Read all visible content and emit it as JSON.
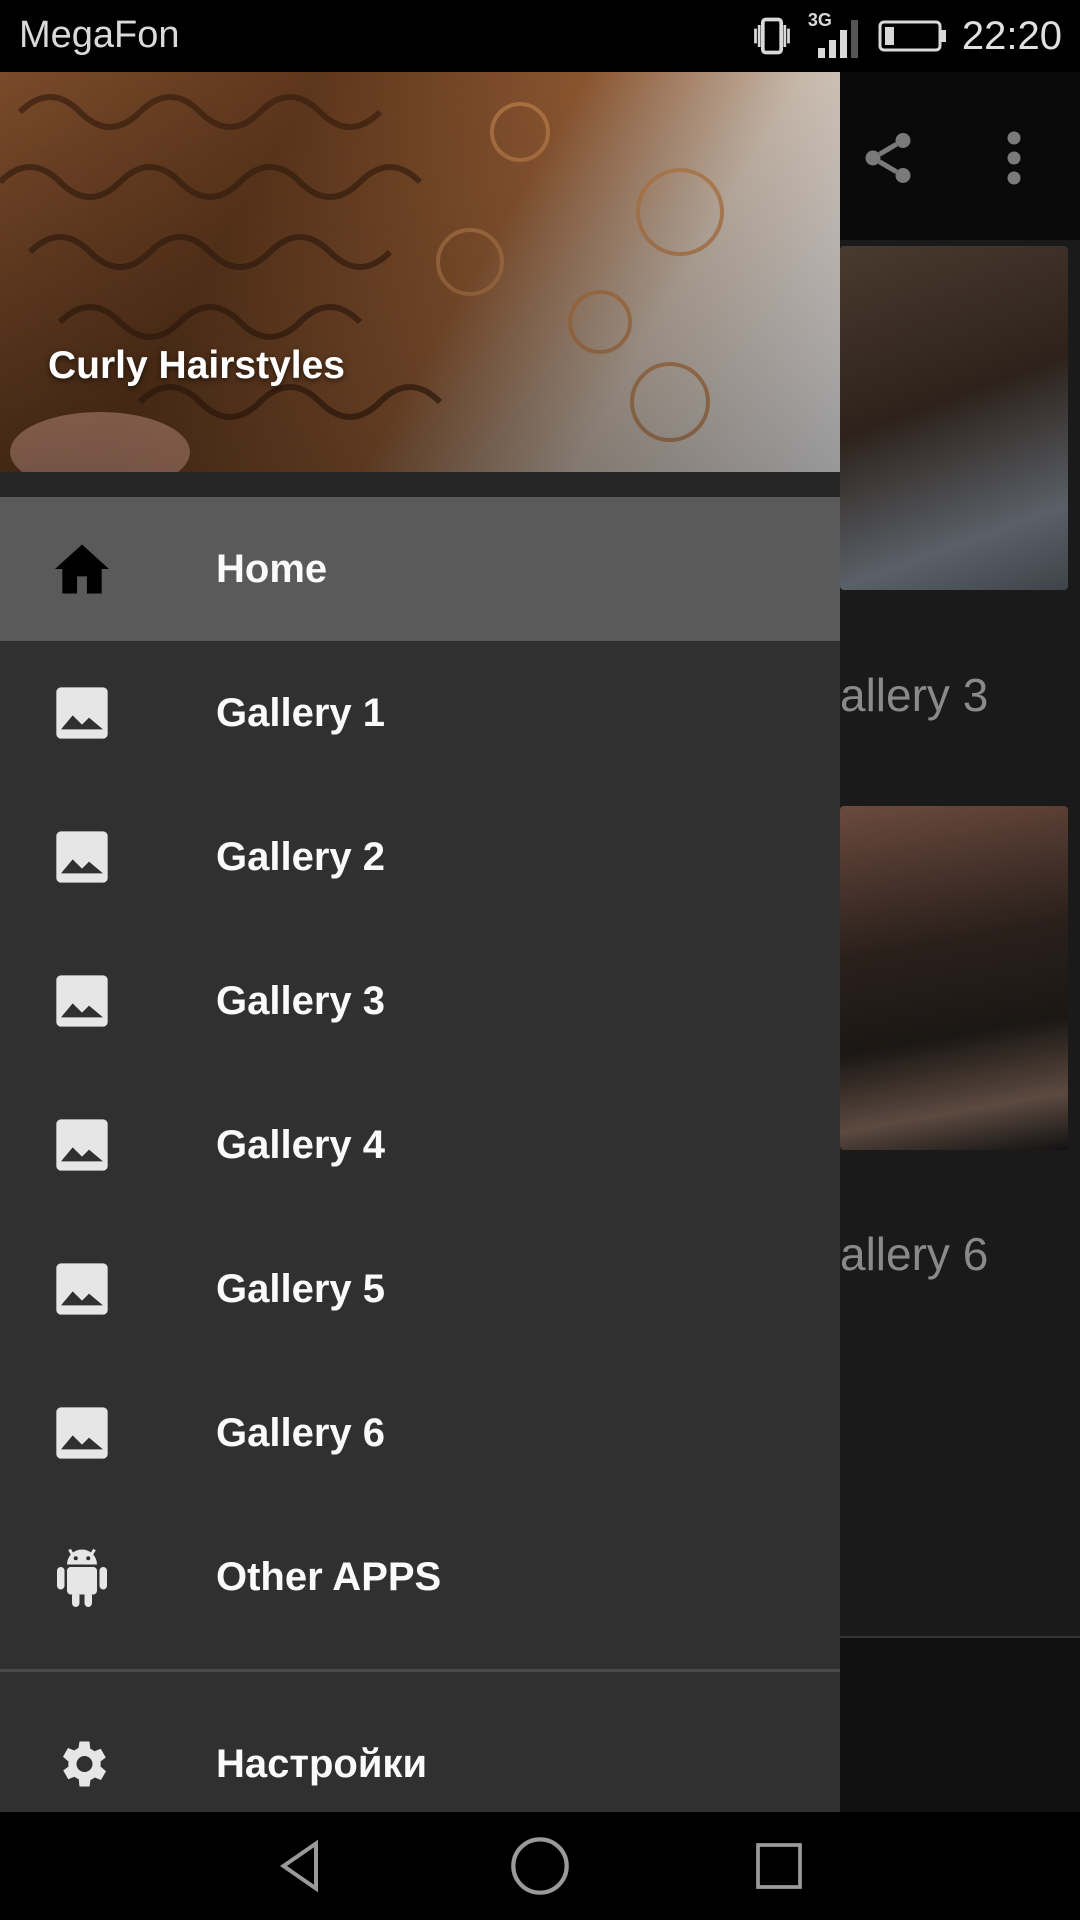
{
  "status_bar": {
    "carrier": "MegaFon",
    "network": "3G",
    "time": "22:20"
  },
  "background_app": {
    "labels": [
      "allery 3",
      "allery 6"
    ]
  },
  "drawer": {
    "header_title": "Curly Hairstyles",
    "items": [
      {
        "label": "Home",
        "icon": "home-icon",
        "active": true
      },
      {
        "label": "Gallery 1",
        "icon": "image-icon"
      },
      {
        "label": "Gallery 2",
        "icon": "image-icon"
      },
      {
        "label": "Gallery 3",
        "icon": "image-icon"
      },
      {
        "label": "Gallery 4",
        "icon": "image-icon"
      },
      {
        "label": "Gallery 5",
        "icon": "image-icon"
      },
      {
        "label": "Gallery 6",
        "icon": "image-icon"
      },
      {
        "label": "Other APPS",
        "icon": "android-icon"
      }
    ],
    "settings_label": "Настройки"
  },
  "colors": {
    "drawer_bg": "#303030",
    "active_item_bg": "#5a5a5a",
    "accent_hair": "#7a4a2a"
  }
}
